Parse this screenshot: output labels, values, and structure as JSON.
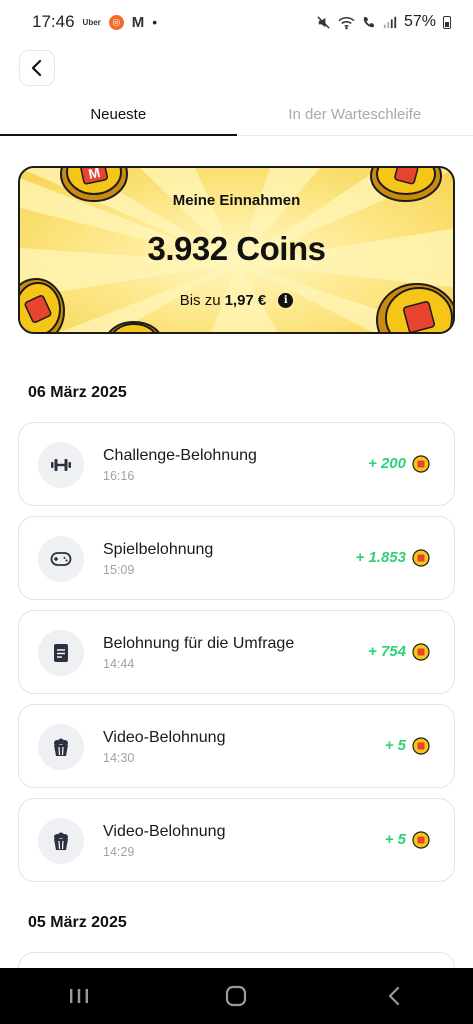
{
  "status_bar": {
    "time": "17:46",
    "uber_label": "Uber",
    "battery": "57%"
  },
  "tabs": [
    {
      "label": "Neueste",
      "active": true
    },
    {
      "label": "In der Warteschleife",
      "active": false
    }
  ],
  "earnings": {
    "title": "Meine Einnahmen",
    "amount": "3.932 Coins",
    "sub_prefix": "Bis zu",
    "sub_value": "1,97 €"
  },
  "sections": [
    {
      "date": "06 März 2025",
      "transactions": [
        {
          "title": "Challenge-Belohnung",
          "time": "16:16",
          "amount": "+ 200",
          "icon": "dumbbell-icon"
        },
        {
          "title": "Spielbelohnung",
          "time": "15:09",
          "amount": "+ 1.853",
          "icon": "gamepad-icon"
        },
        {
          "title": "Belohnung für die Umfrage",
          "time": "14:44",
          "amount": "+ 754",
          "icon": "document-icon"
        },
        {
          "title": "Video-Belohnung",
          "time": "14:30",
          "amount": "+ 5",
          "icon": "popcorn-icon"
        },
        {
          "title": "Video-Belohnung",
          "time": "14:29",
          "amount": "+ 5",
          "icon": "popcorn-icon"
        }
      ]
    },
    {
      "date": "05 März 2025",
      "transactions": []
    }
  ],
  "colors": {
    "accent_green": "#2fd07a",
    "banner_yellow": "#fde88c",
    "coin_gold": "#f5c518",
    "coin_red": "#e8432e"
  }
}
